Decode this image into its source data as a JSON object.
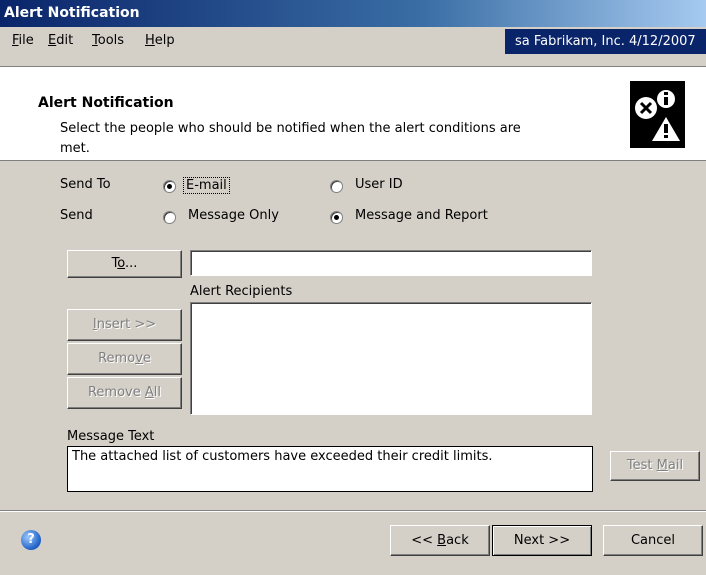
{
  "window": {
    "title": "Alert Notification"
  },
  "menu": {
    "items": [
      {
        "label": "File",
        "mnemonic": "F",
        "rest": "ile"
      },
      {
        "label": "Edit",
        "mnemonic": "E",
        "rest": "dit"
      },
      {
        "label": "Tools",
        "mnemonic": "T",
        "rest": "ools"
      },
      {
        "label": "Help",
        "mnemonic": "H",
        "rest": "elp"
      }
    ],
    "info": "sa  Fabrikam, Inc.  4/12/2007"
  },
  "header": {
    "title": "Alert Notification",
    "description": "Select the people who should be notified when the alert conditions are met.",
    "icon": "alert-warning-icon"
  },
  "send_to": {
    "label": "Send To",
    "options": [
      {
        "label": "E-mail",
        "selected": true
      },
      {
        "label": "User ID",
        "selected": false
      }
    ]
  },
  "send": {
    "label": "Send",
    "options": [
      {
        "label": "Message Only",
        "selected": false
      },
      {
        "label": "Message and Report",
        "selected": true
      }
    ]
  },
  "to_button": {
    "pre": "T",
    "mnemonic": "o",
    "post": "..."
  },
  "to_field": {
    "value": ""
  },
  "recipients": {
    "label": "Alert Recipients",
    "insert": {
      "mnemonic": "I",
      "rest": "nsert >>"
    },
    "remove": {
      "pre": "Remo",
      "mnemonic": "v",
      "post": "e"
    },
    "remove_all": {
      "pre": "Remove ",
      "mnemonic": "A",
      "post": "ll"
    }
  },
  "message": {
    "label": "Message Text",
    "value": "The attached list of customers have exceeded their credit limits.",
    "test_mail": {
      "pre": "Test ",
      "mnemonic": "M",
      "post": "ail"
    }
  },
  "footer": {
    "back": {
      "pre": "<< ",
      "mnemonic": "B",
      "post": "ack"
    },
    "next": "Next >>",
    "cancel": "Cancel"
  },
  "colors": {
    "titlebar": "#0a246a",
    "face": "#d4d0c8"
  }
}
